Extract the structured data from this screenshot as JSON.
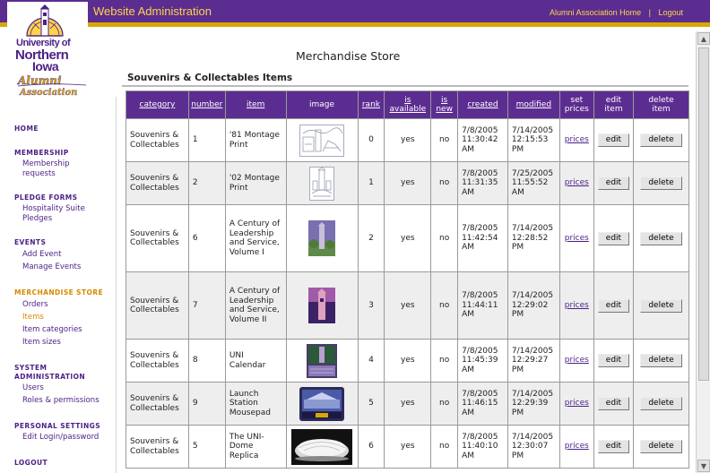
{
  "header": {
    "title": "Website Administration",
    "links": [
      {
        "label": "Alumni Association Home"
      },
      {
        "label": "Logout"
      }
    ]
  },
  "logo": {
    "line1": "University of",
    "line2": "Northern",
    "line3": "Iowa",
    "script1": "Alumni",
    "script2": "Association"
  },
  "sidebar": {
    "sections": [
      {
        "heading": "HOME",
        "items": []
      },
      {
        "heading": "MEMBERSHIP",
        "items": [
          {
            "label": "Membership"
          },
          {
            "label": "requests"
          }
        ]
      },
      {
        "heading": "PLEDGE FORMS",
        "items": [
          {
            "label": "Hospitality Suite"
          },
          {
            "label": "Pledges"
          }
        ]
      },
      {
        "heading": "EVENTS",
        "items": [
          {
            "label": "Add Event"
          },
          {
            "label": "Manage Events"
          }
        ]
      },
      {
        "heading": "MERCHANDISE STORE",
        "items": [
          {
            "label": "Orders"
          },
          {
            "label": "Items"
          },
          {
            "label": "Item categories"
          },
          {
            "label": "Item sizes"
          }
        ]
      },
      {
        "heading": "SYSTEM",
        "heading2": "ADMINISTRATION",
        "items": [
          {
            "label": "Users"
          },
          {
            "label": "Roles & permissions"
          }
        ]
      },
      {
        "heading": "PERSONAL SETTINGS",
        "items": [
          {
            "label": "Edit Login/password"
          }
        ]
      },
      {
        "heading": "LOGOUT",
        "items": []
      }
    ],
    "active_section": "MERCHANDISE STORE",
    "active_item": "Items"
  },
  "main": {
    "page_title": "Merchandise Store",
    "section_title": "Souvenirs & Collectables Items"
  },
  "table": {
    "headers": {
      "category": "category",
      "number": "number",
      "item": "item",
      "image": "image",
      "rank": "rank",
      "is_available_1": "is",
      "is_available_2": "available",
      "is_new_1": "is",
      "is_new_2": "new",
      "created": "created",
      "modified": "modified",
      "set_prices_1": "set",
      "set_prices_2": "prices",
      "edit_1": "edit",
      "edit_2": "item",
      "delete_1": "delete",
      "delete_2": "item"
    },
    "rows": [
      {
        "category": "Souvenirs & Collectables",
        "number": "1",
        "item": "'81 Montage Print",
        "image": "sketch-print",
        "rank": "0",
        "available": "yes",
        "new": "no",
        "created": "7/8/2005 11:30:42 AM",
        "modified": "7/14/2005 12:15:53 PM",
        "prices": "prices",
        "edit": "edit",
        "delete": "delete"
      },
      {
        "category": "Souvenirs & Collectables",
        "number": "2",
        "item": "'02 Montage Print",
        "image": "sketch-print-2",
        "rank": "1",
        "available": "yes",
        "new": "no",
        "created": "7/8/2005 11:31:35 AM",
        "modified": "7/25/2005 11:55:52 AM",
        "prices": "prices",
        "edit": "edit",
        "delete": "delete"
      },
      {
        "category": "Souvenirs & Collectables",
        "number": "6",
        "item": "A Century of Leadership and Service, Volume I",
        "image": "book-cover-1",
        "rank": "2",
        "available": "yes",
        "new": "no",
        "created": "7/8/2005 11:42:54 AM",
        "modified": "7/14/2005 12:28:52 PM",
        "prices": "prices",
        "edit": "edit",
        "delete": "delete"
      },
      {
        "category": "Souvenirs & Collectables",
        "number": "7",
        "item": "A Century of Leadership and Service, Volume II",
        "image": "book-cover-2",
        "rank": "3",
        "available": "yes",
        "new": "no",
        "created": "7/8/2005 11:44:11 AM",
        "modified": "7/14/2005 12:29:02 PM",
        "prices": "prices",
        "edit": "edit",
        "delete": "delete"
      },
      {
        "category": "Souvenirs & Collectables",
        "number": "8",
        "item": "UNI Calendar",
        "image": "calendar",
        "rank": "4",
        "available": "yes",
        "new": "no",
        "created": "7/8/2005 11:45:39 AM",
        "modified": "7/14/2005 12:29:27 PM",
        "prices": "prices",
        "edit": "edit",
        "delete": "delete"
      },
      {
        "category": "Souvenirs & Collectables",
        "number": "9",
        "item": "Launch Station Mousepad",
        "image": "mousepad",
        "rank": "5",
        "available": "yes",
        "new": "no",
        "created": "7/8/2005 11:46:15 AM",
        "modified": "7/14/2005 12:29:39 PM",
        "prices": "prices",
        "edit": "edit",
        "delete": "delete"
      },
      {
        "category": "Souvenirs & Collectables",
        "number": "5",
        "item": "The UNI-Dome Replica",
        "image": "dome-replica",
        "rank": "6",
        "available": "yes",
        "new": "no",
        "created": "7/8/2005 11:40:10 AM",
        "modified": "7/14/2005 12:30:07 PM",
        "prices": "prices",
        "edit": "edit",
        "delete": "delete"
      }
    ]
  },
  "colors": {
    "brand_purple": "#5c2d91",
    "brand_gold": "#d8a800",
    "active_orange": "#d68a00"
  }
}
